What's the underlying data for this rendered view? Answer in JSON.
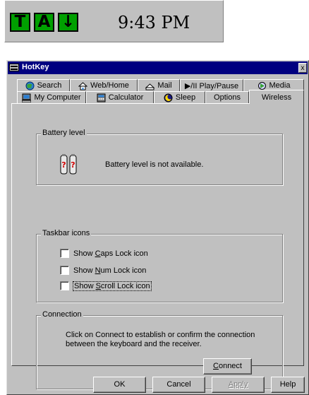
{
  "tray": {
    "icons": [
      {
        "letter": "T",
        "name": "tray-icon-t"
      },
      {
        "letter": "A",
        "name": "tray-icon-a"
      },
      {
        "letter": "↓",
        "name": "tray-icon-scroll-lock"
      }
    ],
    "clock": "9:43 PM"
  },
  "window": {
    "title": "HotKey",
    "close_glyph": "x"
  },
  "tabs": {
    "row1": [
      {
        "label": "Search",
        "icon": "search-icon"
      },
      {
        "label": "Web/Home",
        "icon": "web-home-icon"
      },
      {
        "label": "Mail",
        "icon": "mail-icon"
      },
      {
        "label": "▶/II Play/Pause",
        "icon": "play-pause-icon"
      },
      {
        "label": "Media",
        "icon": "media-icon"
      }
    ],
    "row2": [
      {
        "label": "My Computer",
        "icon": "computer-icon"
      },
      {
        "label": "Calculator",
        "icon": "calculator-icon"
      },
      {
        "label": "Sleep",
        "icon": "sleep-icon"
      },
      {
        "label": "Options",
        "icon": ""
      },
      {
        "label": "Wireless",
        "icon": "",
        "active": true
      }
    ]
  },
  "battery": {
    "group_label": "Battery level",
    "status": "Battery level is not available."
  },
  "taskbar_icons": {
    "group_label": "Taskbar icons",
    "caps": {
      "pre": "Show ",
      "key": "C",
      "post": "aps Lock icon",
      "checked": false
    },
    "num": {
      "pre": "Show ",
      "key": "N",
      "post": "um Lock icon",
      "checked": false
    },
    "scroll": {
      "pre": "Show ",
      "key": "S",
      "post": "croll Lock icon",
      "checked": false
    }
  },
  "connection": {
    "group_label": "Connection",
    "text": "Click on Connect to establish or confirm the connection between the keyboard and the receiver.",
    "button": {
      "key": "C",
      "post": "onnect"
    }
  },
  "footer": {
    "ok": "OK",
    "cancel": "Cancel",
    "apply": "Apply",
    "help": "Help"
  },
  "colors": {
    "titlebar": "#000080",
    "face": "#c0c0c0",
    "tray_icon_green": "#00a000"
  }
}
